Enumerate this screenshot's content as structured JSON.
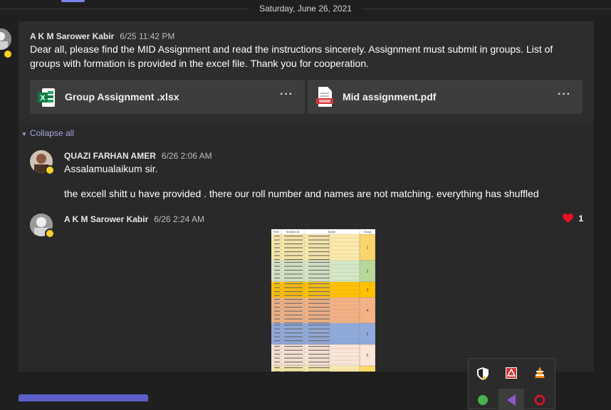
{
  "date_divider": "Saturday, June 26, 2021",
  "post": {
    "author": "A K M Sarower Kabir",
    "time": "6/25 11:42 PM",
    "message": "Dear all, please find the MID Assignment and read the instructions sincerely. Assignment must submit in groups. List of groups with formation is provided in the excel file. Thank you for cooperation.",
    "attachments": [
      {
        "name": "Group Assignment .xlsx",
        "icon": "excel-file-icon",
        "more": "···"
      },
      {
        "name": "Mid assignment.pdf",
        "icon": "pdf-file-icon",
        "more": "···"
      }
    ]
  },
  "collapse_label": "Collapse all",
  "replies": [
    {
      "author": "QUAZI FARHAN AMER",
      "time": "6/26 2:06 AM",
      "lines": [
        "Assalamualaikum sir.",
        "the excell shitt u have provided . there our roll number and names are not matching. everything has shuffled"
      ]
    },
    {
      "author": "A K M Sarower Kabir",
      "time": "6/26 2:24 AM",
      "reaction_count": "1",
      "reaction_icon": "heart-icon"
    }
  ],
  "spreadsheet_preview": {
    "headers": [
      "Roll",
      "Student ID",
      "Name",
      "Group"
    ],
    "group_labels": [
      "1",
      "2",
      "3",
      "4",
      "5",
      "6"
    ]
  },
  "colors": {
    "accent": "#7b83eb",
    "away_status": "#f8d22a",
    "heart": "#e81123"
  }
}
